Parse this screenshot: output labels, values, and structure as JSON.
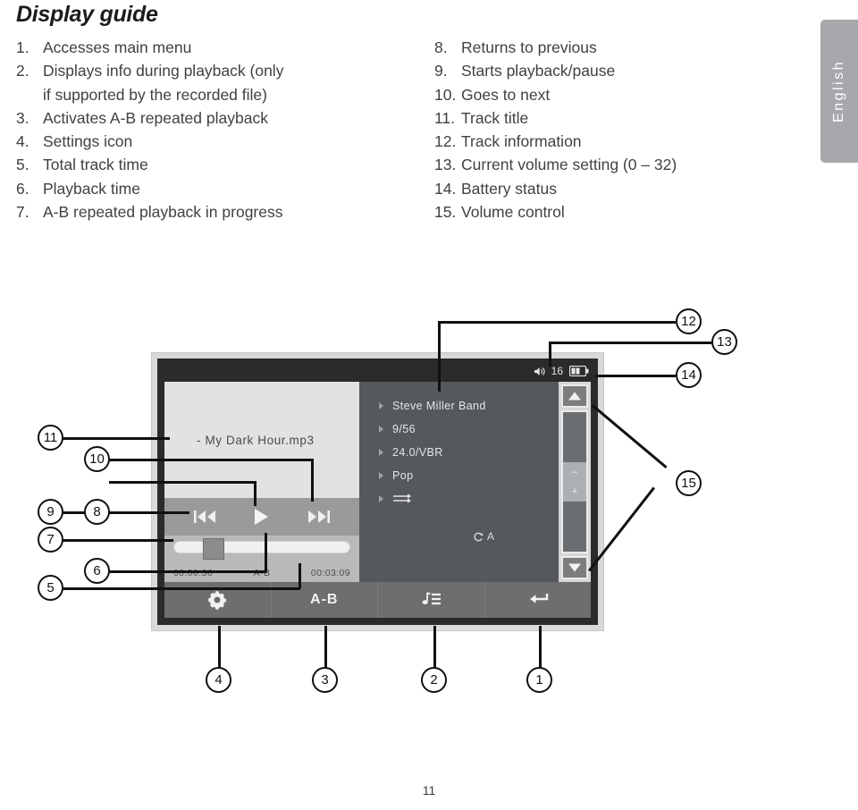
{
  "page": {
    "title": "Display guide",
    "number": "11",
    "language_tab": "English"
  },
  "guide": {
    "left": [
      {
        "num": "1.",
        "text": "Accesses main menu"
      },
      {
        "num": "2.",
        "text": "Displays info during playback (only",
        "cont": "if supported by the recorded file)"
      },
      {
        "num": "3.",
        "text": "Activates A-B repeated playback"
      },
      {
        "num": "4.",
        "text": "Settings icon"
      },
      {
        "num": "5.",
        "text": "Total track time"
      },
      {
        "num": "6.",
        "text": "Playback time"
      },
      {
        "num": "7.",
        "text": "A-B repeated playback in progress"
      }
    ],
    "right": [
      {
        "num": "8.",
        "text": "Returns to previous"
      },
      {
        "num": "9.",
        "text": "Starts playback/pause"
      },
      {
        "num": "10.",
        "text": "Goes to next"
      },
      {
        "num": "11.",
        "text": "Track title"
      },
      {
        "num": "12.",
        "text": "Track information"
      },
      {
        "num": "13.",
        "text": "Current volume setting (0 – 32)"
      },
      {
        "num": "14.",
        "text": "Battery status"
      },
      {
        "num": "15.",
        "text": "Volume control"
      }
    ]
  },
  "device": {
    "status_bar": {
      "volume_value": "16",
      "speaker_icon": "speaker-icon",
      "battery_icon": "battery-icon"
    },
    "track_title": "- My Dark Hour.mp3",
    "transport": {
      "previous_icon": "previous-track-icon",
      "play_icon": "play-icon",
      "next_icon": "next-track-icon"
    },
    "seek": {
      "elapsed_time": "00:00:36",
      "ab_label": "A-B",
      "total_time": "00:03:09"
    },
    "info_rows": [
      {
        "value": "Steve Miller Band"
      },
      {
        "value": "9/56"
      },
      {
        "value": "24.0/VBR"
      },
      {
        "value": "Pop"
      },
      {
        "value": "",
        "icon": "repeat-all-icon"
      }
    ],
    "repeat_a_label": "A",
    "repeat_a_icon": "repeat-ab-icon",
    "volume_control": {
      "up_icon": "volume-up-arrow-icon",
      "down_icon": "volume-down-arrow-icon",
      "minus_label": "–",
      "plus_label": "+"
    },
    "toolbar": [
      {
        "label": "",
        "icon": "gear-icon",
        "name": "settings-button"
      },
      {
        "label": "A-B",
        "icon": "",
        "name": "ab-repeat-button"
      },
      {
        "label": "",
        "icon": "music-list-icon",
        "name": "track-list-button"
      },
      {
        "label": "",
        "icon": "return-arrow-icon",
        "name": "return-button"
      }
    ]
  },
  "callouts": [
    {
      "n": "1"
    },
    {
      "n": "2"
    },
    {
      "n": "3"
    },
    {
      "n": "4"
    },
    {
      "n": "5"
    },
    {
      "n": "6"
    },
    {
      "n": "7"
    },
    {
      "n": "8"
    },
    {
      "n": "9"
    },
    {
      "n": "10"
    },
    {
      "n": "11"
    },
    {
      "n": "12"
    },
    {
      "n": "13"
    },
    {
      "n": "14"
    },
    {
      "n": "15"
    }
  ],
  "colors": {
    "tab_gray": "#a6a8ab",
    "screen_dark": "#55585c",
    "screen_light": "#e2e2e2",
    "toolbar": "#6e6e6e",
    "ink": "#111111"
  }
}
